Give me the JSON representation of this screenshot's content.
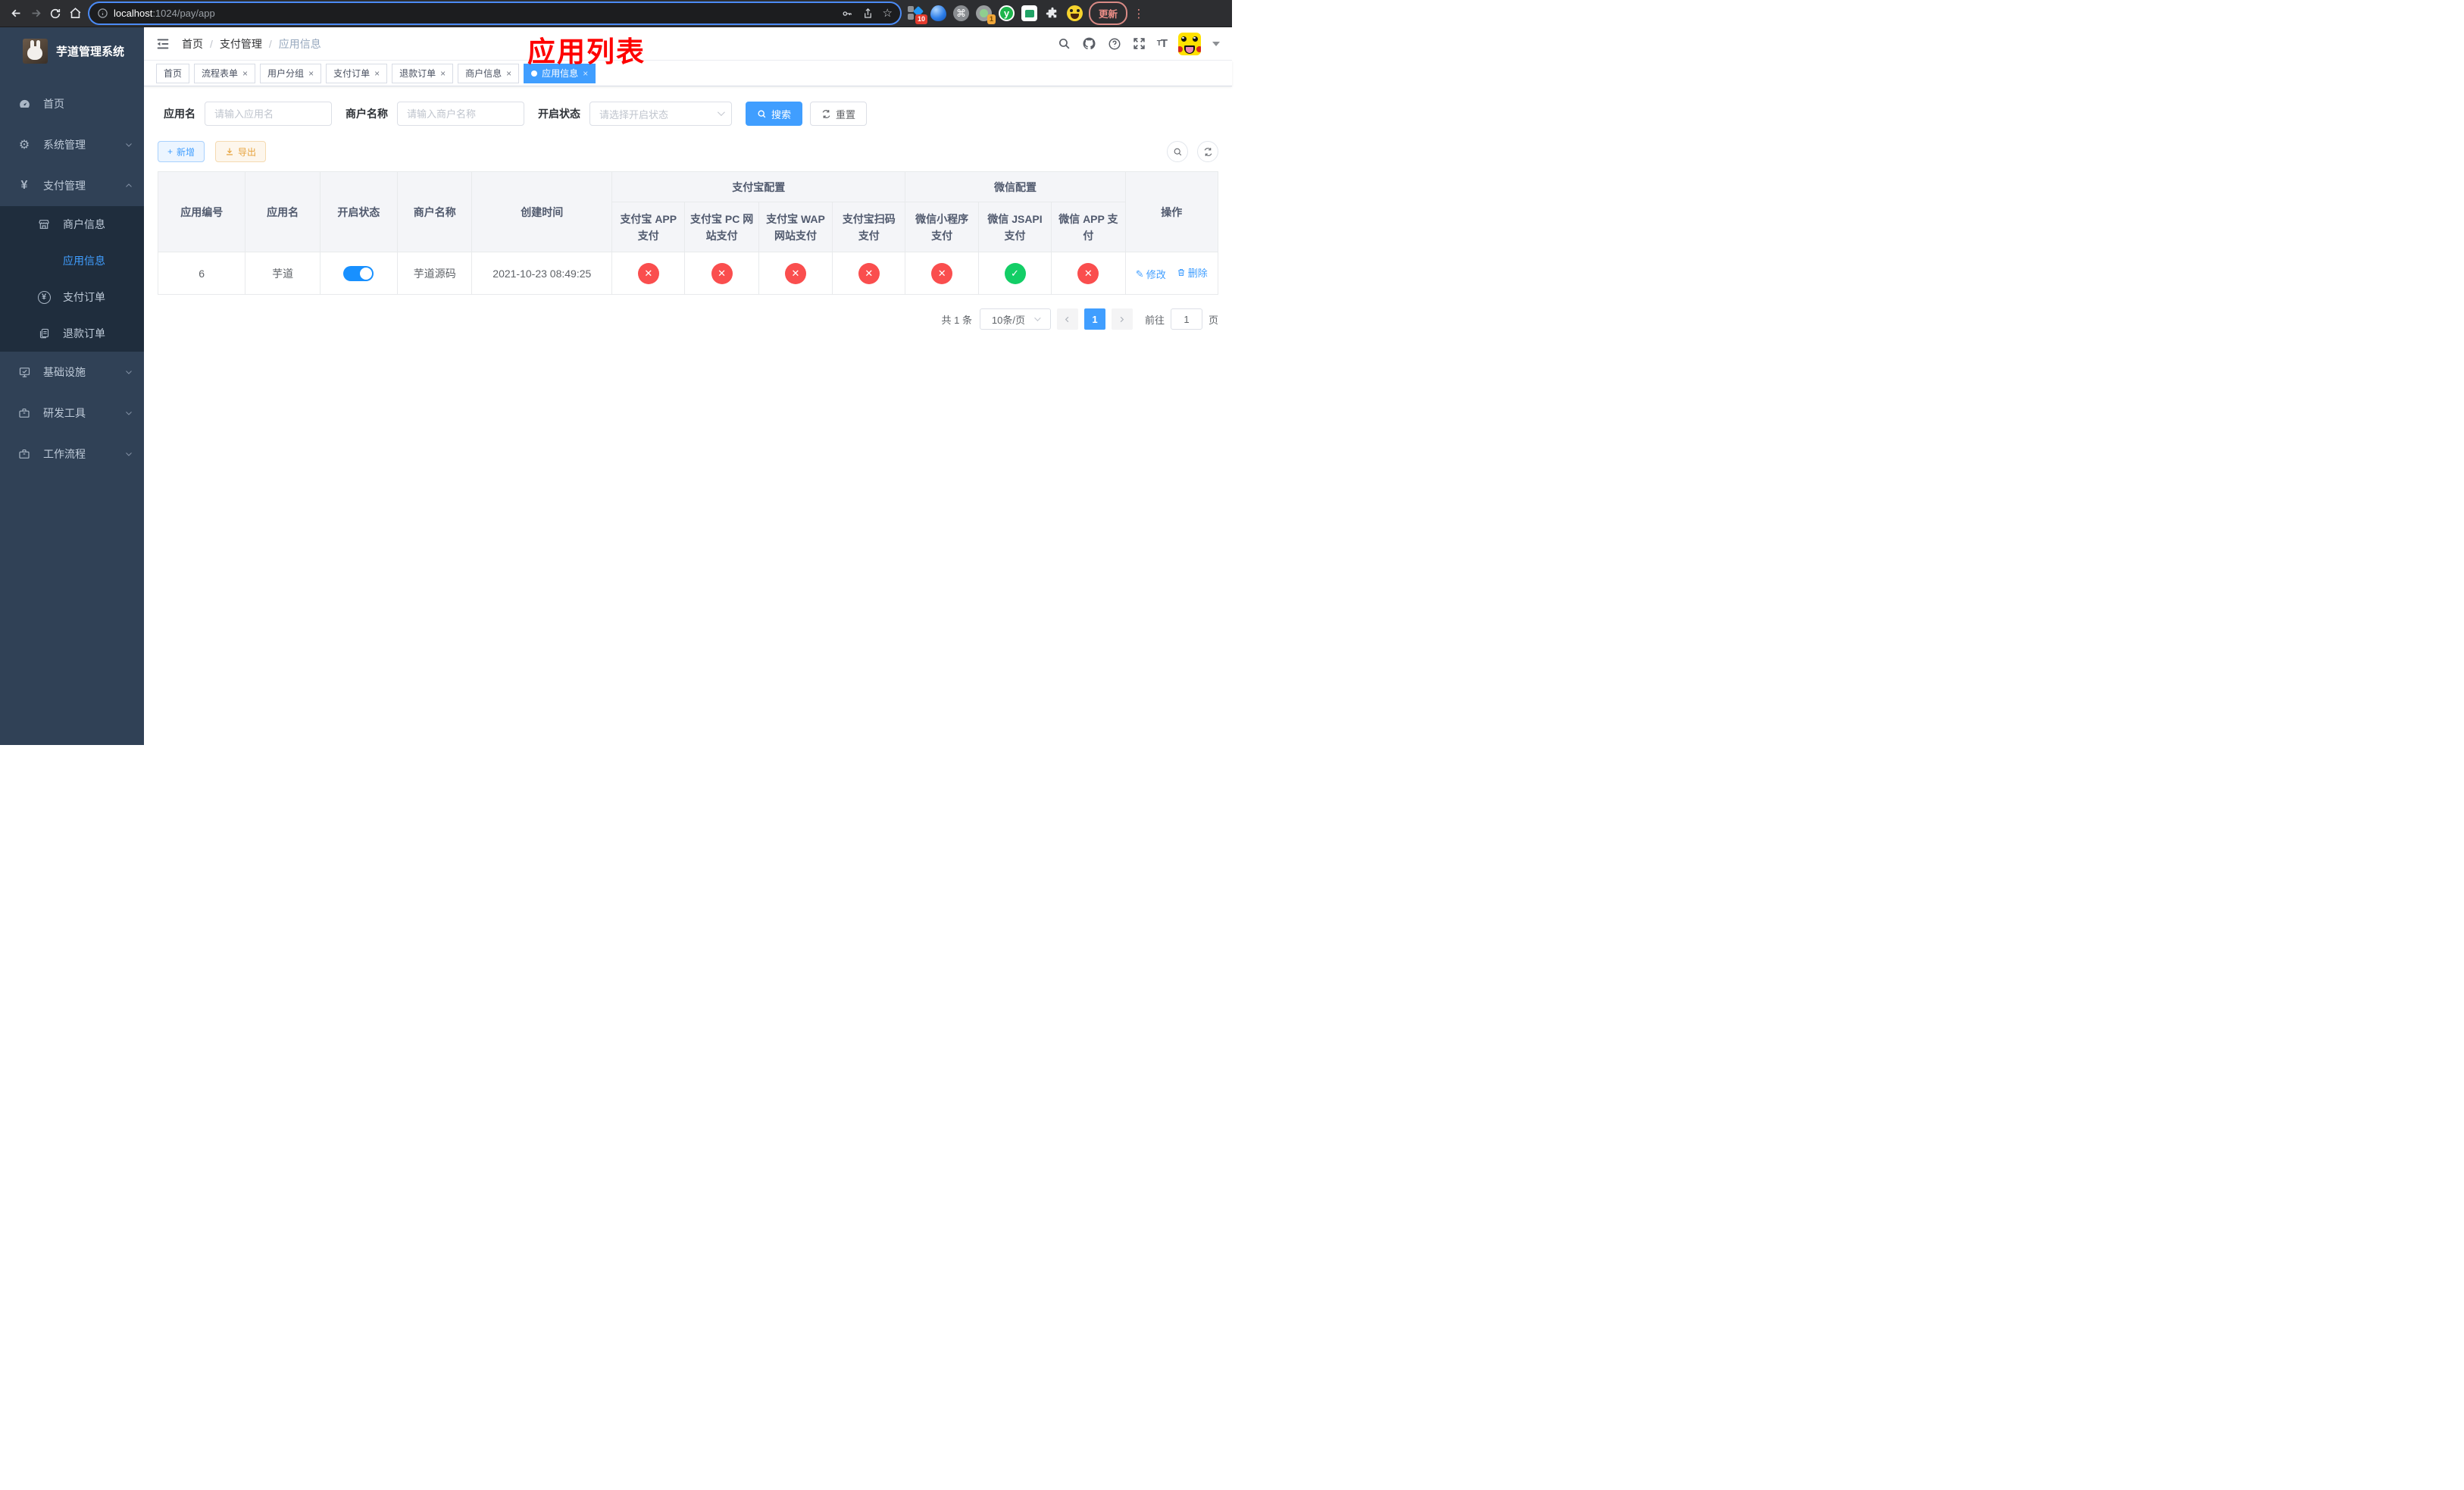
{
  "browser": {
    "url": {
      "host": "localhost",
      "path": ":1024/pay/app"
    },
    "update_button": "更新",
    "badges": {
      "sketch": "10",
      "target": "1"
    },
    "ext_letter_y": "y"
  },
  "icons": {
    "gear": "⚙",
    "yen": "¥",
    "pencil": "✎",
    "check": "✓",
    "cross": "✕",
    "command": "⌘",
    "plus": "+",
    "dots": "⋮",
    "star": "☆",
    "question": "?",
    "tt_big": "T",
    "tt_small": "T"
  },
  "sidebar": {
    "title": "芋道管理系统",
    "items": [
      {
        "label": "首页",
        "icon": "dashboard-icon"
      },
      {
        "label": "系统管理",
        "icon": "gear-icon",
        "chevron": "down"
      },
      {
        "label": "支付管理",
        "icon": "yen-icon",
        "chevron": "up"
      },
      {
        "label": "基础设施",
        "icon": "monitor-icon",
        "chevron": "down"
      },
      {
        "label": "研发工具",
        "icon": "toolbox-icon",
        "chevron": "down"
      },
      {
        "label": "工作流程",
        "icon": "toolbox-icon",
        "chevron": "down"
      }
    ],
    "submenu": [
      {
        "label": "商户信息",
        "icon": "store-icon",
        "active": false
      },
      {
        "label": "应用信息",
        "icon": "grid-icon",
        "active": true
      },
      {
        "label": "支付订单",
        "icon": "circle-yen-icon",
        "active": false
      },
      {
        "label": "退款订单",
        "icon": "document-icon",
        "active": false
      }
    ]
  },
  "navbar": {
    "breadcrumb": [
      "首页",
      "支付管理",
      "应用信息"
    ],
    "annotation": "应用列表"
  },
  "tabs": [
    {
      "label": "首页",
      "closable": false,
      "active": false
    },
    {
      "label": "流程表单",
      "closable": true,
      "active": false
    },
    {
      "label": "用户分组",
      "closable": true,
      "active": false
    },
    {
      "label": "支付订单",
      "closable": true,
      "active": false
    },
    {
      "label": "退款订单",
      "closable": true,
      "active": false
    },
    {
      "label": "商户信息",
      "closable": true,
      "active": false
    },
    {
      "label": "应用信息",
      "closable": true,
      "active": true
    }
  ],
  "filters": {
    "app_name_label": "应用名",
    "app_name_placeholder": "请输入应用名",
    "merchant_label": "商户名称",
    "merchant_placeholder": "请输入商户名称",
    "status_label": "开启状态",
    "status_placeholder": "请选择开启状态",
    "search_button": "搜索",
    "reset_button": "重置"
  },
  "toolbar": {
    "add_button": "新增",
    "export_button": "导出"
  },
  "table": {
    "headers": {
      "app_id": "应用编号",
      "app_name": "应用名",
      "status": "开启状态",
      "merchant": "商户名称",
      "created": "创建时间",
      "alipay_group": "支付宝配置",
      "wechat_group": "微信配置",
      "operation": "操作",
      "channels": [
        "支付宝 APP 支付",
        "支付宝 PC 网站支付",
        "支付宝 WAP 网站支付",
        "支付宝扫码支付",
        "微信小程序支付",
        "微信 JSAPI 支付",
        "微信 APP 支付"
      ]
    },
    "rows": [
      {
        "app_id": "6",
        "app_name": "芋道",
        "enabled": true,
        "merchant": "芋道源码",
        "created": "2021-10-23 08:49:25",
        "channels": [
          "no",
          "no",
          "no",
          "no",
          "no",
          "yes",
          "no"
        ],
        "edit_action": "修改",
        "delete_action": "删除"
      }
    ]
  },
  "pagination": {
    "total": "共 1 条",
    "page_size": "10条/页",
    "current_page": "1",
    "goto_label": "前往",
    "goto_value": "1",
    "page_unit": "页"
  },
  "colors": {
    "primary": "#409eff",
    "success": "#13ce66",
    "danger": "#fa4e4e",
    "warning": "#e6a23c",
    "annotation_red": "#fe0100",
    "sidebar_bg": "#304156",
    "submenu_bg": "#1f2d3d"
  }
}
